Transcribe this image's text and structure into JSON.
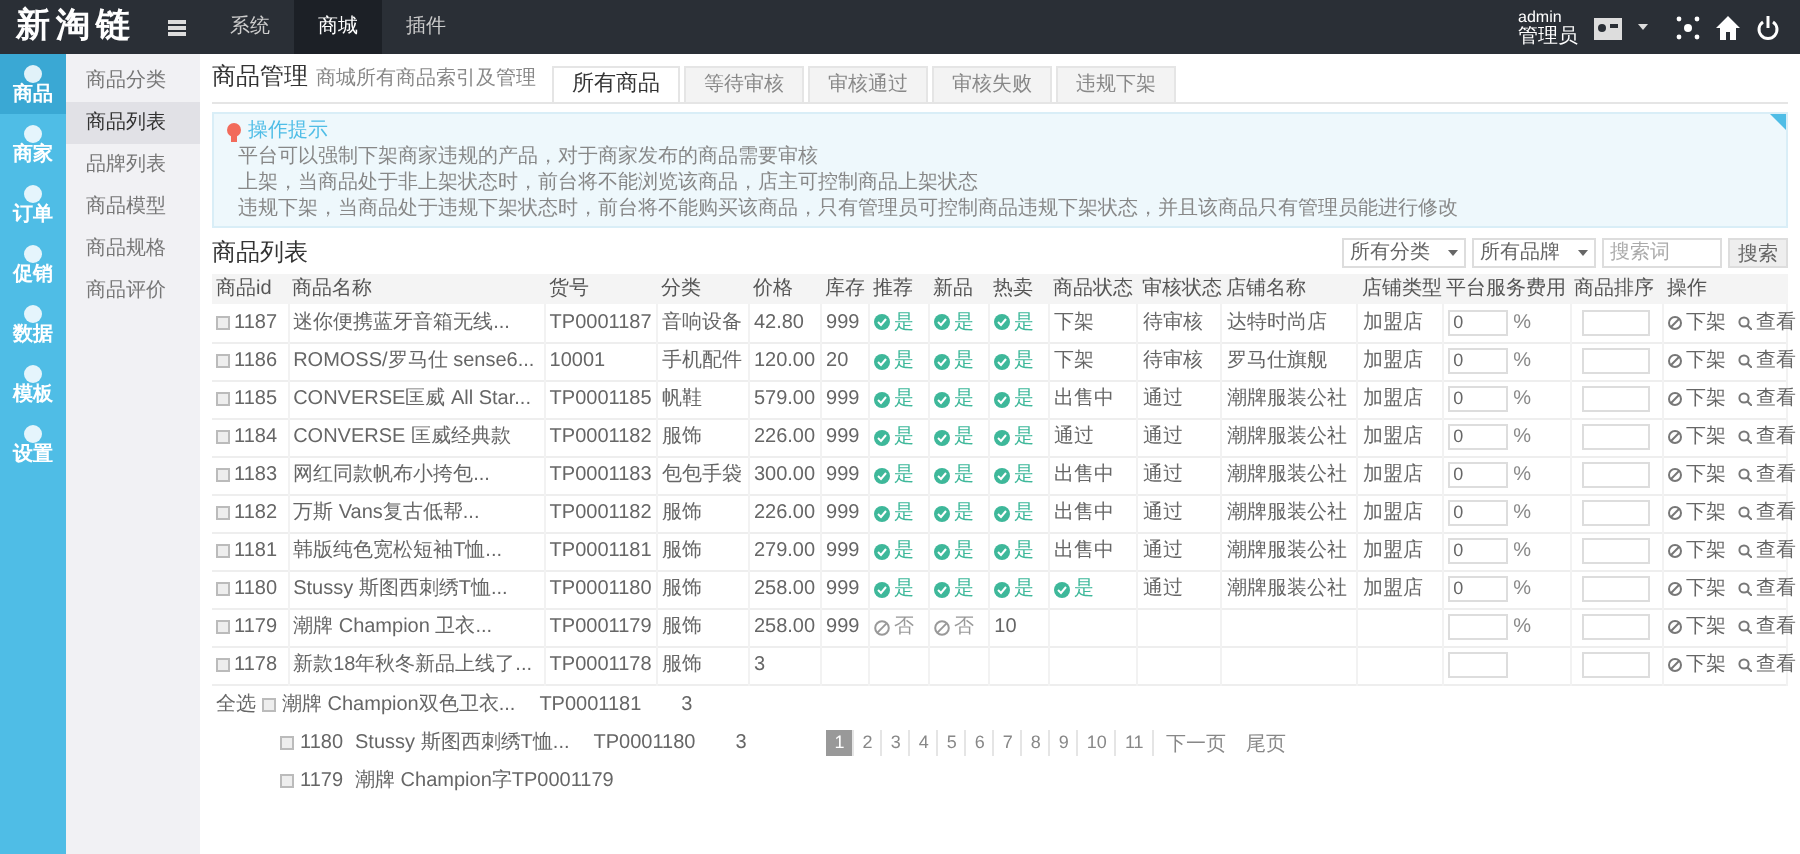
{
  "topbar": {
    "logo": "新淘链",
    "nav": [
      {
        "label": "系统",
        "selected": false
      },
      {
        "label": "商城",
        "selected": true
      },
      {
        "label": "插件",
        "selected": false
      }
    ],
    "user": {
      "name": "admin",
      "role": "管理员"
    }
  },
  "rail": [
    {
      "label": "商品",
      "selected": true
    },
    {
      "label": "商家",
      "selected": false
    },
    {
      "label": "订单",
      "selected": false
    },
    {
      "label": "促销",
      "selected": false
    },
    {
      "label": "数据",
      "selected": false
    },
    {
      "label": "模板",
      "selected": false
    },
    {
      "label": "设置",
      "selected": false
    }
  ],
  "submenu": [
    {
      "label": "商品分类",
      "selected": false
    },
    {
      "label": "商品列表",
      "selected": true
    },
    {
      "label": "品牌列表",
      "selected": false
    },
    {
      "label": "商品模型",
      "selected": false
    },
    {
      "label": "商品规格",
      "selected": false
    },
    {
      "label": "商品评价",
      "selected": false
    }
  ],
  "page": {
    "title": "商品管理",
    "subtitle": "商城所有商品索引及管理",
    "tabs": [
      {
        "label": "所有商品",
        "selected": true
      },
      {
        "label": "等待审核",
        "selected": false
      },
      {
        "label": "审核通过",
        "selected": false
      },
      {
        "label": "审核失败",
        "selected": false
      },
      {
        "label": "违规下架",
        "selected": false
      }
    ]
  },
  "tips": {
    "title": "操作提示",
    "lines": [
      "平台可以强制下架商家违规的产品，对于商家发布的商品需要审核",
      "上架，当商品处于非上架状态时，前台将不能浏览该商品，店主可控制商品上架状态",
      "违规下架，当商品处于违规下架状态时，前台将不能购买该商品，只有管理员可控制商品违规下架状态，并且该商品只有管理员能进行修改"
    ]
  },
  "list": {
    "title": "商品列表",
    "filters": [
      {
        "kind": "select",
        "value": "所有分类"
      },
      {
        "kind": "select",
        "value": "所有品牌"
      },
      {
        "kind": "input",
        "placeholder": "搜索词"
      }
    ],
    "search_button": "搜索"
  },
  "table": {
    "columns": [
      "商品id",
      "商品名称",
      "货号",
      "分类",
      "价格",
      "库存",
      "推荐",
      "新品",
      "热卖",
      "商品状态",
      "审核状态",
      "店铺名称",
      "店铺类型",
      "平台服务费用",
      "商品排序",
      "操作"
    ],
    "rows": [
      {
        "cells": [
          {
            "kind": "check",
            "checked": false,
            "text": "1187"
          },
          {
            "kind": "text",
            "text": "迷你便携蓝牙音箱无线..."
          },
          {
            "kind": "text",
            "text": "TP0001187"
          },
          {
            "kind": "text",
            "text": "音响设备"
          },
          {
            "kind": "text",
            "text": "42.80"
          },
          {
            "kind": "text",
            "text": "999"
          },
          {
            "kind": "flag",
            "on": true,
            "text": "是"
          },
          {
            "kind": "flag",
            "on": true,
            "text": "是"
          },
          {
            "kind": "flag",
            "on": true,
            "text": "是"
          },
          {
            "kind": "text",
            "text": "下架"
          },
          {
            "kind": "text",
            "text": "待审核"
          },
          {
            "kind": "text",
            "text": "达特时尚店"
          },
          {
            "kind": "text",
            "text": "加盟店"
          },
          {
            "kind": "fee",
            "value": "0",
            "unit": "%"
          },
          {
            "kind": "sort"
          },
          {
            "kind": "actions",
            "items": [
              "下架",
              "查看"
            ]
          }
        ]
      },
      {
        "cells": [
          {
            "kind": "check",
            "checked": false,
            "text": "1186"
          },
          {
            "kind": "text",
            "text": "ROMOSS/罗马仕 sense6..."
          },
          {
            "kind": "text",
            "text": "10001"
          },
          {
            "kind": "text",
            "text": "手机配件"
          },
          {
            "kind": "text",
            "text": "120.00"
          },
          {
            "kind": "text",
            "text": "20"
          },
          {
            "kind": "flag",
            "on": true,
            "text": "是"
          },
          {
            "kind": "flag",
            "on": true,
            "text": "是"
          },
          {
            "kind": "flag",
            "on": true,
            "text": "是"
          },
          {
            "kind": "text",
            "text": "下架"
          },
          {
            "kind": "text",
            "text": "待审核"
          },
          {
            "kind": "text",
            "text": "罗马仕旗舰"
          },
          {
            "kind": "text",
            "text": "加盟店"
          },
          {
            "kind": "fee",
            "value": "0",
            "unit": "%"
          },
          {
            "kind": "sort"
          },
          {
            "kind": "actions",
            "items": [
              "下架",
              "查看"
            ]
          }
        ]
      },
      {
        "cells": [
          {
            "kind": "check",
            "checked": false,
            "text": "1185"
          },
          {
            "kind": "text",
            "text": "CONVERSE匡威 All Star..."
          },
          {
            "kind": "text",
            "text": "TP0001185"
          },
          {
            "kind": "text",
            "text": "帆鞋"
          },
          {
            "kind": "text",
            "text": "579.00"
          },
          {
            "kind": "text",
            "text": "999"
          },
          {
            "kind": "flag",
            "on": true,
            "text": "是"
          },
          {
            "kind": "flag",
            "on": true,
            "text": "是"
          },
          {
            "kind": "flag",
            "on": true,
            "text": "是"
          },
          {
            "kind": "text",
            "text": "出售中"
          },
          {
            "kind": "text",
            "text": "通过"
          },
          {
            "kind": "text",
            "text": "潮牌服装公社"
          },
          {
            "kind": "text",
            "text": "加盟店"
          },
          {
            "kind": "fee",
            "value": "0",
            "unit": "%"
          },
          {
            "kind": "sort"
          },
          {
            "kind": "actions",
            "items": [
              "下架",
              "查看"
            ]
          }
        ]
      },
      {
        "cells": [
          {
            "kind": "check",
            "checked": false,
            "text": "1184"
          },
          {
            "kind": "text",
            "text": "CONVERSE 匡威经典款"
          },
          {
            "kind": "text",
            "text": "TP0001182"
          },
          {
            "kind": "text",
            "text": "服饰"
          },
          {
            "kind": "text",
            "text": "226.00"
          },
          {
            "kind": "text",
            "text": "999"
          },
          {
            "kind": "flag",
            "on": true,
            "text": "是"
          },
          {
            "kind": "flag",
            "on": true,
            "text": "是"
          },
          {
            "kind": "flag",
            "on": true,
            "text": "是"
          },
          {
            "kind": "text",
            "text": "通过"
          },
          {
            "kind": "text",
            "text": "通过"
          },
          {
            "kind": "text",
            "text": "潮牌服装公社"
          },
          {
            "kind": "text",
            "text": "加盟店"
          },
          {
            "kind": "fee",
            "value": "0",
            "unit": "%"
          },
          {
            "kind": "sort"
          },
          {
            "kind": "actions",
            "items": [
              "下架",
              "查看"
            ]
          }
        ]
      },
      {
        "cells": [
          {
            "kind": "check",
            "checked": false,
            "text": "1183"
          },
          {
            "kind": "text",
            "text": "网红同款帆布小挎包..."
          },
          {
            "kind": "text",
            "text": "TP0001183"
          },
          {
            "kind": "text",
            "text": "包包手袋"
          },
          {
            "kind": "text",
            "text": "300.00"
          },
          {
            "kind": "text",
            "text": "999"
          },
          {
            "kind": "flag",
            "on": true,
            "text": "是"
          },
          {
            "kind": "flag",
            "on": true,
            "text": "是"
          },
          {
            "kind": "flag",
            "on": true,
            "text": "是"
          },
          {
            "kind": "text",
            "text": "出售中"
          },
          {
            "kind": "text",
            "text": "通过"
          },
          {
            "kind": "text",
            "text": "潮牌服装公社"
          },
          {
            "kind": "text",
            "text": "加盟店"
          },
          {
            "kind": "fee",
            "value": "0",
            "unit": "%"
          },
          {
            "kind": "sort"
          },
          {
            "kind": "actions",
            "items": [
              "下架",
              "查看"
            ]
          }
        ]
      },
      {
        "cells": [
          {
            "kind": "check",
            "checked": false,
            "text": "1182"
          },
          {
            "kind": "text",
            "text": "万斯 Vans复古低帮..."
          },
          {
            "kind": "text",
            "text": "TP0001182"
          },
          {
            "kind": "text",
            "text": "服饰"
          },
          {
            "kind": "text",
            "text": "226.00"
          },
          {
            "kind": "text",
            "text": "999"
          },
          {
            "kind": "flag",
            "on": true,
            "text": "是"
          },
          {
            "kind": "flag",
            "on": true,
            "text": "是"
          },
          {
            "kind": "flag",
            "on": true,
            "text": "是"
          },
          {
            "kind": "text",
            "text": "出售中"
          },
          {
            "kind": "text",
            "text": "通过"
          },
          {
            "kind": "text",
            "text": "潮牌服装公社"
          },
          {
            "kind": "text",
            "text": "加盟店"
          },
          {
            "kind": "fee",
            "value": "0",
            "unit": "%"
          },
          {
            "kind": "sort"
          },
          {
            "kind": "actions",
            "items": [
              "下架",
              "查看"
            ]
          }
        ]
      },
      {
        "cells": [
          {
            "kind": "check",
            "checked": false,
            "text": "1181"
          },
          {
            "kind": "text",
            "text": "韩版纯色宽松短袖T恤..."
          },
          {
            "kind": "text",
            "text": "TP0001181"
          },
          {
            "kind": "text",
            "text": "服饰"
          },
          {
            "kind": "text",
            "text": "279.00"
          },
          {
            "kind": "text",
            "text": "999"
          },
          {
            "kind": "flag",
            "on": true,
            "text": "是"
          },
          {
            "kind": "flag",
            "on": true,
            "text": "是"
          },
          {
            "kind": "flag",
            "on": true,
            "text": "是"
          },
          {
            "kind": "text",
            "text": "出售中"
          },
          {
            "kind": "text",
            "text": "通过"
          },
          {
            "kind": "text",
            "text": "潮牌服装公社"
          },
          {
            "kind": "text",
            "text": "加盟店"
          },
          {
            "kind": "fee",
            "value": "0",
            "unit": "%"
          },
          {
            "kind": "sort"
          },
          {
            "kind": "actions",
            "items": [
              "下架",
              "查看"
            ]
          }
        ]
      },
      {
        "cells": [
          {
            "kind": "check",
            "checked": false,
            "text": "1180"
          },
          {
            "kind": "text",
            "text": "Stussy 斯图西刺绣T恤..."
          },
          {
            "kind": "text",
            "text": "TP0001180"
          },
          {
            "kind": "text",
            "text": "服饰"
          },
          {
            "kind": "text",
            "text": "258.00"
          },
          {
            "kind": "text",
            "text": "999"
          },
          {
            "kind": "flag",
            "on": true,
            "text": "是"
          },
          {
            "kind": "flag",
            "on": true,
            "text": "是"
          },
          {
            "kind": "flag",
            "on": true,
            "text": "是"
          },
          {
            "kind": "flag",
            "on": true,
            "text": "是"
          },
          {
            "kind": "text",
            "text": "通过"
          },
          {
            "kind": "text",
            "text": "潮牌服装公社"
          },
          {
            "kind": "text",
            "text": "加盟店"
          },
          {
            "kind": "fee",
            "value": "0",
            "unit": "%"
          },
          {
            "kind": "sort"
          },
          {
            "kind": "actions",
            "items": [
              "下架",
              "查看"
            ]
          }
        ]
      },
      {
        "cells": [
          {
            "kind": "check",
            "checked": false,
            "text": "1179"
          },
          {
            "kind": "text",
            "text": "潮牌 Champion 卫衣..."
          },
          {
            "kind": "text",
            "text": "TP0001179"
          },
          {
            "kind": "text",
            "text": "服饰"
          },
          {
            "kind": "text",
            "text": "258.00"
          },
          {
            "kind": "text",
            "text": "999"
          },
          {
            "kind": "flag",
            "on": false,
            "text": "否"
          },
          {
            "kind": "flag",
            "on": false,
            "text": "否"
          },
          {
            "kind": "text",
            "text": "10"
          },
          {
            "kind": "blank"
          },
          {
            "kind": "blank"
          },
          {
            "kind": "blank"
          },
          {
            "kind": "blank"
          },
          {
            "kind": "fee",
            "unit": "%"
          },
          {
            "kind": "sort"
          },
          {
            "kind": "actions",
            "items": [
              "下架",
              "查看"
            ]
          }
        ]
      },
      {
        "cells": [
          {
            "kind": "check",
            "checked": false,
            "text": "1178"
          },
          {
            "kind": "text",
            "text": "新款18年秋冬新品上线了..."
          },
          {
            "kind": "text",
            "text": "TP0001178"
          },
          {
            "kind": "text",
            "text": "服饰"
          },
          {
            "kind": "text",
            "text": "3"
          },
          {
            "kind": "blank"
          },
          {
            "kind": "blank"
          },
          {
            "kind": "blank"
          },
          {
            "kind": "blank"
          },
          {
            "kind": "blank"
          },
          {
            "kind": "blank"
          },
          {
            "kind": "blank"
          },
          {
            "kind": "blank"
          },
          {
            "kind": "fee"
          },
          {
            "kind": "sort"
          },
          {
            "kind": "actions",
            "items": [
              "下架",
              "查看"
            ]
          }
        ]
      }
    ]
  },
  "footer": {
    "select_all": "全选",
    "ghost_rows": [
      {
        "checked": false,
        "name": "潮牌 Champion双色卫衣...",
        "sn": "TP0001181",
        "value": "3"
      },
      {
        "checked": false,
        "id": "1180",
        "name": "Stussy 斯图西刺绣T恤...",
        "sn": "TP0001180",
        "value": "3"
      },
      {
        "checked": false,
        "id": "1179",
        "name": "潮牌 Champion字TP0001179"
      }
    ]
  },
  "pagination": {
    "pages": [
      {
        "label": "1",
        "selected": true
      },
      {
        "label": "2",
        "selected": false
      },
      {
        "label": "3",
        "selected": false
      },
      {
        "label": "4",
        "selected": false
      },
      {
        "label": "5",
        "selected": false
      },
      {
        "label": "6",
        "selected": false
      },
      {
        "label": "7",
        "selected": false
      },
      {
        "label": "8",
        "selected": false
      },
      {
        "label": "9",
        "selected": false
      },
      {
        "label": "10",
        "selected": false
      },
      {
        "label": "11",
        "selected": false
      }
    ],
    "next": "下一页",
    "last": "尾页"
  }
}
